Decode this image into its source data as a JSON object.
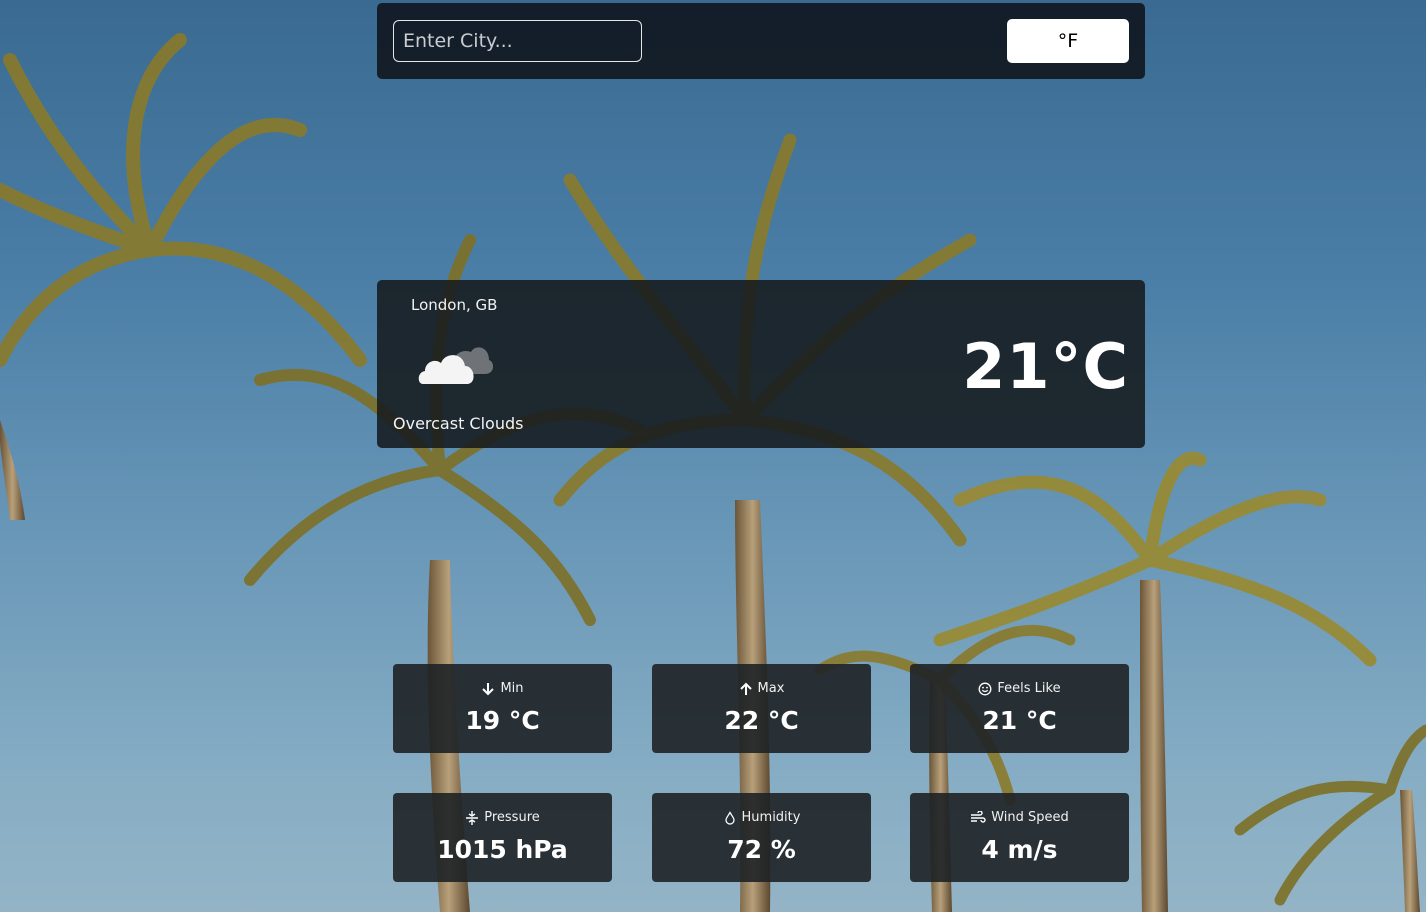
{
  "search": {
    "placeholder": "Enter City...",
    "value": ""
  },
  "unit_toggle": {
    "label": "°F"
  },
  "current": {
    "location": "London, GB",
    "icon": "overcast-clouds-icon",
    "description": "Overcast Clouds",
    "temperature": "21°C"
  },
  "stats": [
    {
      "label": "Min",
      "value": "19 °C",
      "icon": "arrow-down-icon"
    },
    {
      "label": "Max",
      "value": "22 °C",
      "icon": "arrow-up-icon"
    },
    {
      "label": "Feels Like",
      "value": "21 °C",
      "icon": "smile-icon"
    },
    {
      "label": "Pressure",
      "value": "1015 hPa",
      "icon": "pressure-icon"
    },
    {
      "label": "Humidity",
      "value": "72 %",
      "icon": "droplet-icon"
    },
    {
      "label": "Wind Speed",
      "value": "4 m/s",
      "icon": "wind-icon"
    }
  ],
  "colors": {
    "panel": "#121a24",
    "card": "#1e2226",
    "text": "#ffffff",
    "sky_top": "#3a6a92",
    "sky_bottom": "#94b4c6",
    "palm_frond": "#8a7a2a"
  }
}
